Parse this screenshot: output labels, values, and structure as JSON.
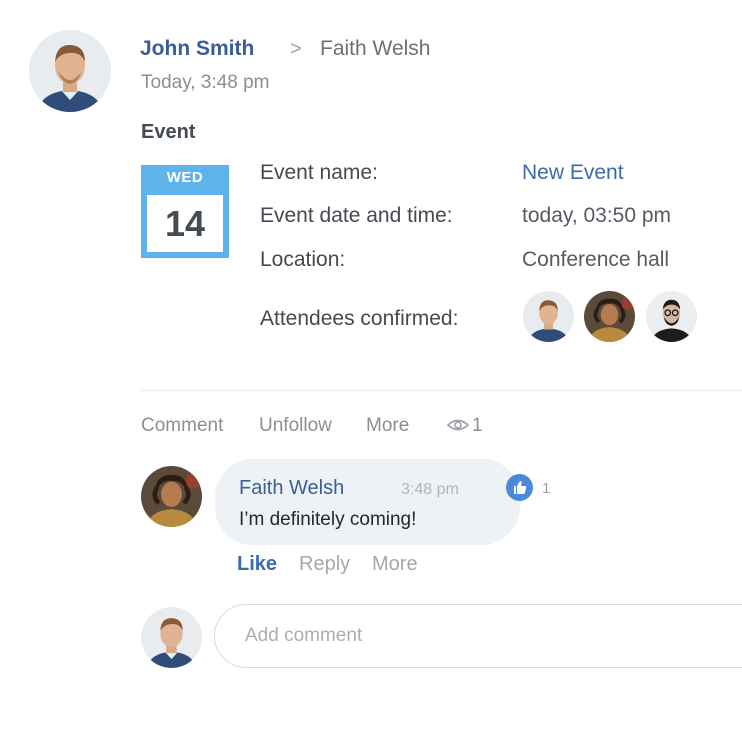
{
  "post": {
    "author": "John Smith",
    "arrow": ">",
    "recipient": "Faith Welsh",
    "time": "Today, 3:48 pm",
    "section_title": "Event"
  },
  "event": {
    "calendar": {
      "day": "WED",
      "date": "14",
      "color": "#5eb3ea"
    },
    "fields": [
      {
        "label": "Event name:",
        "value": "New Event"
      },
      {
        "label": "Event date and time:",
        "value": "today, 03:50 pm"
      },
      {
        "label": "Location:",
        "value": "Conference hall"
      }
    ],
    "attendees_label": "Attendees confirmed:",
    "attendees": [
      "John Smith",
      "Faith Welsh",
      "attendee-3"
    ]
  },
  "actions": {
    "comment": "Comment",
    "unfollow": "Unfollow",
    "more": "More",
    "views": "1"
  },
  "comment": {
    "author": "Faith Welsh",
    "time": "3:48 pm",
    "text": "I’m definitely coming!",
    "likes": "1",
    "like": "Like",
    "reply": "Reply",
    "more": "More"
  },
  "add_comment": {
    "placeholder": "Add comment"
  },
  "colors": {
    "author_link": "#3b5e94",
    "value_link": "#3d6aa6",
    "like_badge": "#4a8ad8"
  }
}
